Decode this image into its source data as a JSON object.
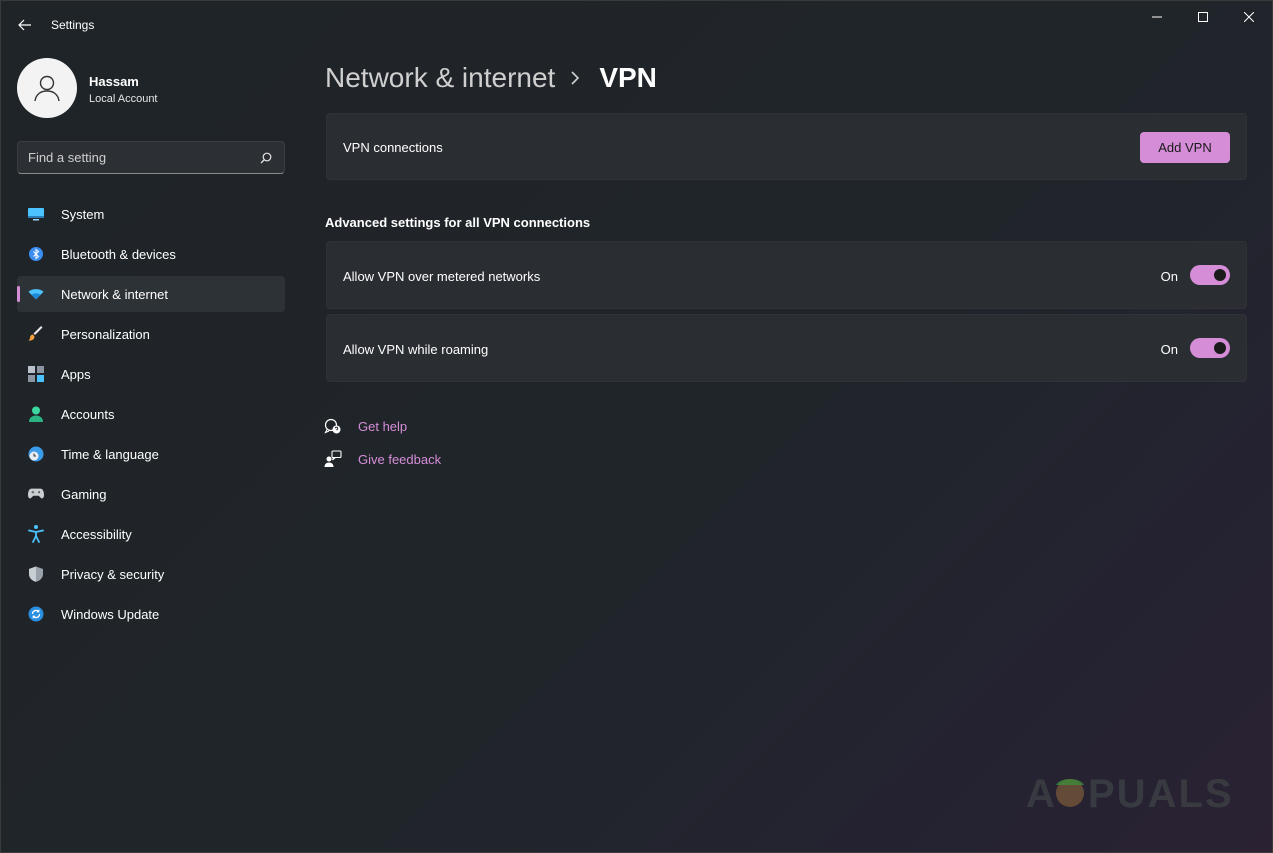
{
  "window": {
    "title": "Settings"
  },
  "profile": {
    "name": "Hassam",
    "account_type": "Local Account"
  },
  "search": {
    "placeholder": "Find a setting"
  },
  "sidebar": {
    "items": [
      {
        "label": "System",
        "icon": "monitor-icon",
        "active": false
      },
      {
        "label": "Bluetooth & devices",
        "icon": "bluetooth-icon",
        "active": false
      },
      {
        "label": "Network & internet",
        "icon": "wifi-icon",
        "active": true
      },
      {
        "label": "Personalization",
        "icon": "brush-icon",
        "active": false
      },
      {
        "label": "Apps",
        "icon": "apps-icon",
        "active": false
      },
      {
        "label": "Accounts",
        "icon": "person-icon",
        "active": false
      },
      {
        "label": "Time & language",
        "icon": "globe-clock-icon",
        "active": false
      },
      {
        "label": "Gaming",
        "icon": "gamepad-icon",
        "active": false
      },
      {
        "label": "Accessibility",
        "icon": "accessibility-icon",
        "active": false
      },
      {
        "label": "Privacy & security",
        "icon": "shield-icon",
        "active": false
      },
      {
        "label": "Windows Update",
        "icon": "update-icon",
        "active": false
      }
    ]
  },
  "breadcrumb": {
    "parent": "Network & internet",
    "current": "VPN"
  },
  "vpn_connections": {
    "label": "VPN connections",
    "add_button": "Add VPN"
  },
  "advanced": {
    "heading": "Advanced settings for all VPN connections",
    "settings": [
      {
        "label": "Allow VPN over metered networks",
        "state": "On",
        "enabled": true
      },
      {
        "label": "Allow VPN while roaming",
        "state": "On",
        "enabled": true
      }
    ]
  },
  "links": {
    "help": "Get help",
    "feedback": "Give feedback"
  },
  "watermark": {
    "text": "APPUALS"
  },
  "colors": {
    "accent": "#d58dd8",
    "card": "#2a2e32",
    "background": "#202428"
  }
}
